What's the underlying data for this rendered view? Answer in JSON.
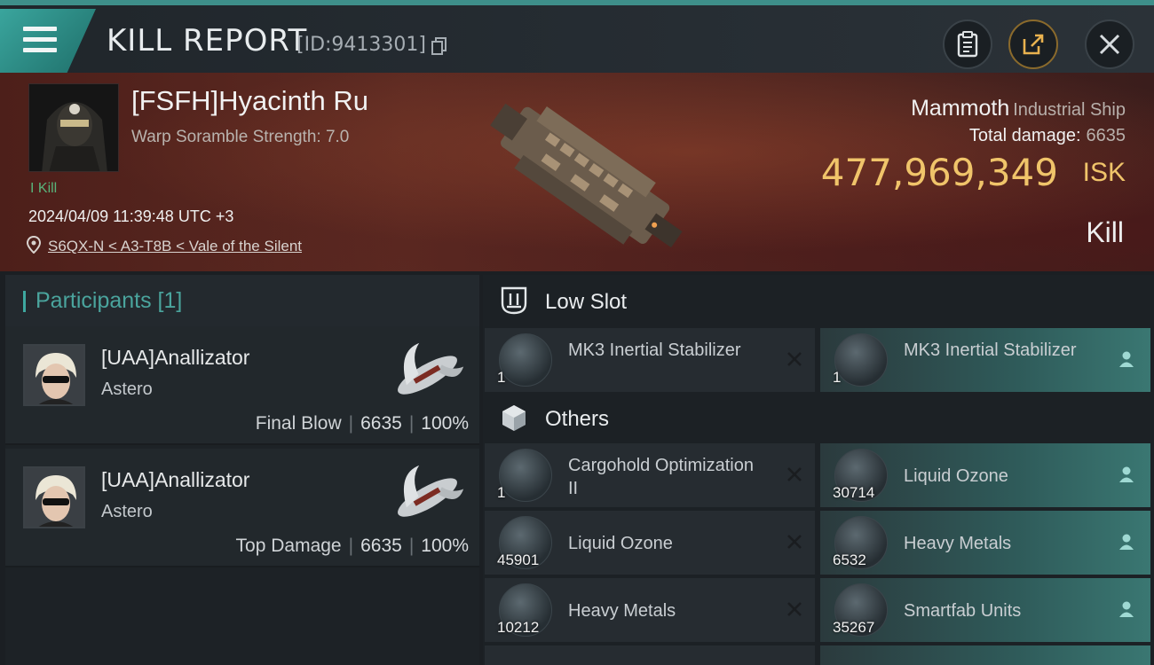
{
  "header": {
    "title": "KILL REPORT",
    "report_id": "[ID:9413301]"
  },
  "victim": {
    "name": "[FSFH]Hyacinth Ru",
    "warp_scramble": "Warp Soramble Strength: 7.0",
    "kill_count": "I Kill",
    "datetime": "2024/04/09 11:39:48 UTC +3",
    "location": "S6QX-N < A3-T8B < Vale of the Silent",
    "ship_name": "Mammoth",
    "ship_class": "Industrial Ship",
    "total_damage_label": "Total damage:",
    "total_damage": "6635",
    "isk_value": "477,969,349",
    "isk_unit": "ISK",
    "result": "Kill"
  },
  "participants": {
    "title": "Participants [1]",
    "rows": [
      {
        "name": "[UAA]Anallizator",
        "ship": "Astero",
        "role": "Final Blow",
        "damage": "6635",
        "percent": "100%"
      },
      {
        "name": "[UAA]Anallizator",
        "ship": "Astero",
        "role": "Top Damage",
        "damage": "6635",
        "percent": "100%"
      }
    ]
  },
  "fittings": {
    "low_slot_title": "Low Slot",
    "others_title": "Others",
    "low_slot": [
      {
        "name": "MK3 Inertial Stabilizer",
        "qty": "1",
        "status": "destroyed"
      },
      {
        "name": "MK3 Inertial Stabilizer",
        "qty": "1",
        "status": "dropped"
      }
    ],
    "others": [
      {
        "name": "Cargohold Optimization II",
        "qty": "1",
        "status": "destroyed"
      },
      {
        "name": "Liquid Ozone",
        "qty": "30714",
        "status": "dropped"
      },
      {
        "name": "Liquid Ozone",
        "qty": "45901",
        "status": "destroyed"
      },
      {
        "name": "Heavy Metals",
        "qty": "6532",
        "status": "dropped"
      },
      {
        "name": "Heavy Metals",
        "qty": "10212",
        "status": "destroyed"
      },
      {
        "name": "Smartfab Units",
        "qty": "35267",
        "status": "dropped"
      }
    ]
  },
  "colors": {
    "accent_teal": "#3ea8a0",
    "isk_gold": "#f0c46a",
    "kill_green": "#58b47b"
  },
  "icons": [
    "menu-icon",
    "copy-icon",
    "clipboard-icon",
    "share-icon",
    "close-icon",
    "location-pin-icon",
    "low-slot-icon",
    "others-cube-icon",
    "destroyed-x-icon",
    "dropped-person-icon"
  ]
}
